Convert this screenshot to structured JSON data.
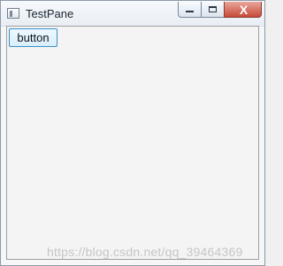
{
  "window": {
    "title": "TestPane",
    "controls": {
      "minimize_icon": "minimize-icon",
      "maximize_icon": "maximize-icon",
      "close_icon": "close-icon",
      "close_glyph": "X"
    }
  },
  "main": {
    "button_label": "button"
  },
  "watermark": {
    "text": "https://blog.csdn.net/qq_39464369"
  },
  "colors": {
    "button_border": "#3c8fc8",
    "close_button": "#c74a38",
    "window_border": "#8e9aa6"
  }
}
